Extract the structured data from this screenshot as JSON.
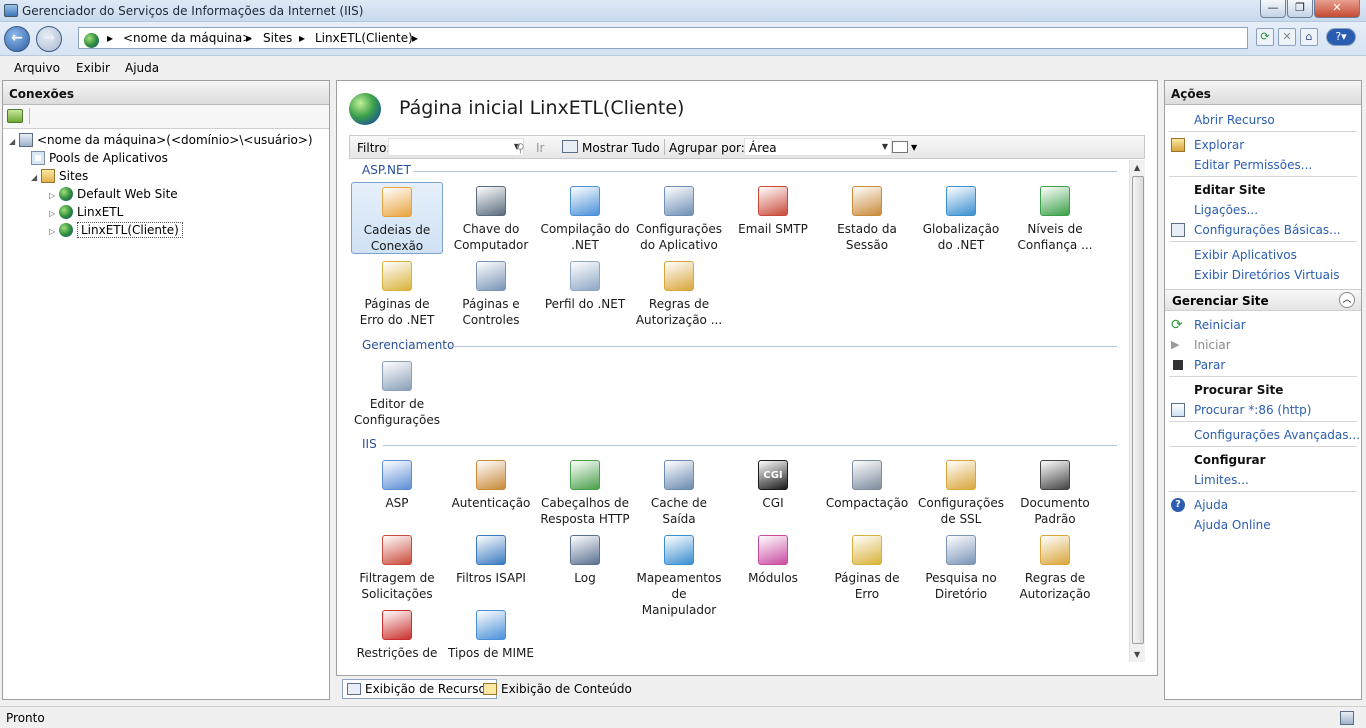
{
  "window": {
    "title": "Gerenciador do Serviços de Informações da Internet (IIS)",
    "minimize": "—",
    "maximize": "❐",
    "close": "✕"
  },
  "address": {
    "segments": [
      "<nome da máquina>",
      "Sites",
      "LinxETL(Cliente)"
    ],
    "separator": "▸"
  },
  "menu": {
    "items": [
      "Arquivo",
      "Exibir",
      "Ajuda"
    ]
  },
  "connections": {
    "header": "Conexões",
    "tree": [
      {
        "label": "<nome da máquina>(<domínio>\\<usuário>)",
        "icon": "server-icon",
        "expander": "◢"
      },
      {
        "label": "Pools de Aplicativos",
        "icon": "app-pools-icon",
        "expander": ""
      },
      {
        "label": "Sites",
        "icon": "sites-folder-icon",
        "expander": "◢"
      },
      {
        "label": "Default Web Site",
        "icon": "website-globe-icon",
        "expander": "▷"
      },
      {
        "label": "LinxETL",
        "icon": "website-globe-icon",
        "expander": "▷"
      },
      {
        "label": "LinxETL(Cliente)",
        "icon": "website-globe-icon",
        "expander": "▷"
      }
    ]
  },
  "center": {
    "title": "Página inicial LinxETL(Cliente)",
    "filter_label": "Filtro:",
    "go_label": "Ir",
    "show_all_label": "Mostrar Tudo",
    "group_label": "Agrupar por:",
    "group_value": "Área",
    "sections": [
      {
        "name": "ASP.NET",
        "features": [
          {
            "label": "Cadeias de Conexão",
            "icon": "connection-strings-icon",
            "color": "#e8a33c"
          },
          {
            "label": "Chave do Computador",
            "icon": "machine-key-icon",
            "color": "#5a6b7d"
          },
          {
            "label": "Compilação do .NET",
            "icon": "net-compilation-icon",
            "color": "#4a90d9"
          },
          {
            "label": "Configurações do Aplicativo",
            "icon": "app-settings-icon",
            "color": "#6f8fb5"
          },
          {
            "label": "Email SMTP",
            "icon": "smtp-email-icon",
            "color": "#c94a3a"
          },
          {
            "label": "Estado da Sessão",
            "icon": "session-state-icon",
            "color": "#c98a3a"
          },
          {
            "label": "Globalização do .NET",
            "icon": "net-globalization-icon",
            "color": "#3a8fd0"
          },
          {
            "label": "Níveis de Confiança ...",
            "icon": "trust-levels-icon",
            "color": "#3aa048"
          },
          {
            "label": "Páginas de Erro do .NET",
            "icon": "net-error-pages-icon",
            "color": "#d9b23a"
          },
          {
            "label": "Páginas e Controles",
            "icon": "pages-controls-icon",
            "color": "#7a95b8"
          },
          {
            "label": "Perfil do .NET",
            "icon": "net-profile-icon",
            "color": "#8ea7c4"
          },
          {
            "label": "Regras de Autorização ...",
            "icon": "authorization-rules-icon",
            "color": "#d9a63a"
          }
        ]
      },
      {
        "name": "Gerenciamento",
        "features": [
          {
            "label": "Editor de Configurações",
            "icon": "config-editor-icon",
            "color": "#8a9fb8"
          }
        ]
      },
      {
        "name": "IIS",
        "features": [
          {
            "label": "ASP",
            "icon": "asp-icon",
            "color": "#5b8ed6"
          },
          {
            "label": "Autenticação",
            "icon": "authentication-icon",
            "color": "#c98a3a"
          },
          {
            "label": "Cabeçalhos de Resposta HTTP",
            "icon": "http-headers-icon",
            "color": "#4aa04a"
          },
          {
            "label": "Cache de Saída",
            "icon": "output-cache-icon",
            "color": "#6b8ab0"
          },
          {
            "label": "CGI",
            "icon": "cgi-icon",
            "color": "#1a1a1a"
          },
          {
            "label": "Compactação",
            "icon": "compression-icon",
            "color": "#7d8c9e"
          },
          {
            "label": "Configurações de SSL",
            "icon": "ssl-lock-icon",
            "color": "#d9a63a"
          },
          {
            "label": "Documento Padrão",
            "icon": "default-document-icon",
            "color": "#444444"
          },
          {
            "label": "Filtragem de Solicitações",
            "icon": "request-filtering-icon",
            "color": "#c94a3a"
          },
          {
            "label": "Filtros ISAPI",
            "icon": "isapi-filters-icon",
            "color": "#3a7ac0"
          },
          {
            "label": "Log",
            "icon": "log-icon",
            "color": "#5a7090"
          },
          {
            "label": "Mapeamentos de Manipulador",
            "icon": "handler-mappings-icon",
            "color": "#3a8fd0"
          },
          {
            "label": "Módulos",
            "icon": "modules-icon",
            "color": "#c94aa0"
          },
          {
            "label": "Páginas de Erro",
            "icon": "error-pages-icon",
            "color": "#d9b23a"
          },
          {
            "label": "Pesquisa no Diretório",
            "icon": "directory-browsing-icon",
            "color": "#7a95b8"
          },
          {
            "label": "Regras de Autorização",
            "icon": "iis-authorization-rules-icon",
            "color": "#d9a63a"
          },
          {
            "label": "Restrições de IP",
            "icon": "ip-restrictions-icon",
            "color": "#c9302c"
          },
          {
            "label": "Tipos de MIME",
            "icon": "mime-types-icon",
            "color": "#4a90d9"
          }
        ]
      }
    ],
    "view_tabs": [
      "Exibição de Recursos",
      "Exibição de Conteúdo"
    ]
  },
  "actions": {
    "header": "Ações",
    "items": [
      {
        "label": "Abrir Recurso",
        "kind": "link"
      },
      {
        "label": "Explorar",
        "kind": "link",
        "icon": "explore-folder-icon"
      },
      {
        "label": "Editar Permissões...",
        "kind": "link"
      },
      {
        "label": "Editar Site",
        "kind": "heading"
      },
      {
        "label": "Ligações...",
        "kind": "link"
      },
      {
        "label": "Configurações Básicas...",
        "kind": "link",
        "icon": "basic-settings-icon"
      },
      {
        "label": "Exibir Aplicativos",
        "kind": "link"
      },
      {
        "label": "Exibir Diretórios Virtuais",
        "kind": "link"
      },
      {
        "label": "Reiniciar",
        "kind": "link",
        "icon": "restart-icon"
      },
      {
        "label": "Iniciar",
        "kind": "disabled",
        "icon": "start-icon"
      },
      {
        "label": "Parar",
        "kind": "link",
        "icon": "stop-icon"
      },
      {
        "label": "Procurar Site",
        "kind": "heading"
      },
      {
        "label": "Procurar *:86 (http)",
        "kind": "link",
        "icon": "browse-icon"
      },
      {
        "label": "Configurações Avançadas...",
        "kind": "link"
      },
      {
        "label": "Configurar",
        "kind": "heading"
      },
      {
        "label": "Limites...",
        "kind": "link"
      },
      {
        "label": "Ajuda",
        "kind": "link",
        "icon": "help-icon"
      },
      {
        "label": "Ajuda Online",
        "kind": "link"
      }
    ],
    "manage_header": "Gerenciar Site"
  },
  "status": {
    "text": "Pronto"
  },
  "colors": {
    "link": "#2a5db0",
    "section": "#2a4f9a",
    "selection": "#cfe1f4"
  }
}
